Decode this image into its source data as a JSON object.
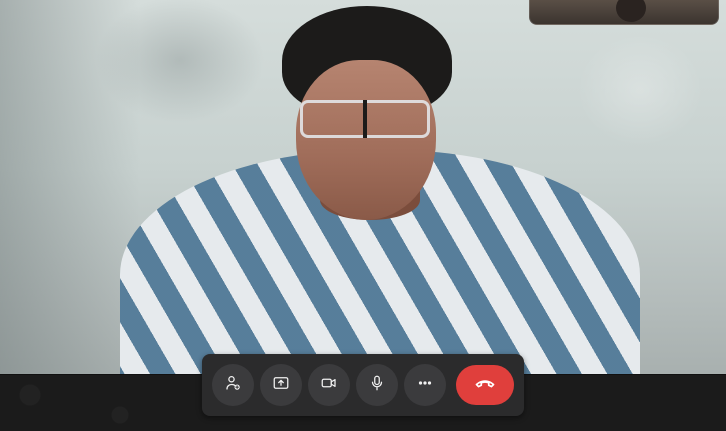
{
  "call": {
    "remote_video": "remote-participant-video",
    "self_view": "self-preview-video"
  },
  "controls": [
    {
      "id": "add-participant",
      "icon": "add-person-icon"
    },
    {
      "id": "share-screen",
      "icon": "share-screen-icon"
    },
    {
      "id": "camera",
      "icon": "video-camera-icon"
    },
    {
      "id": "microphone",
      "icon": "microphone-icon"
    },
    {
      "id": "more",
      "icon": "more-options-icon"
    },
    {
      "id": "end-call",
      "icon": "hang-up-icon",
      "color": "#e03f3c"
    }
  ],
  "colors": {
    "control_bar": "#2b2b2c",
    "control_button": "#3b3b3d",
    "end_call": "#e03f3c",
    "icon": "#f1f1f1"
  }
}
